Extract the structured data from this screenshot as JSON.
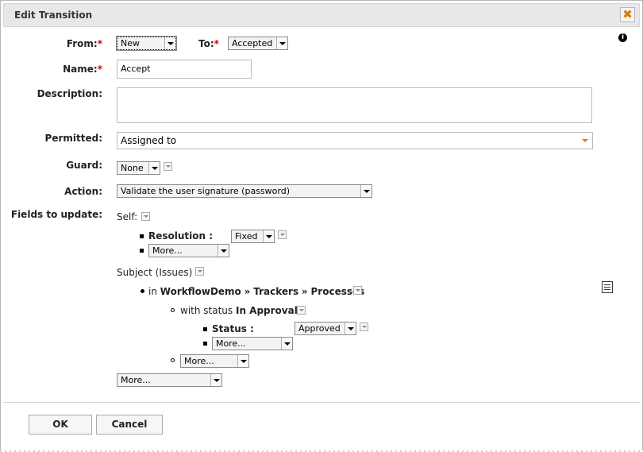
{
  "dialog": {
    "title": "Edit Transition",
    "close_label": "✖"
  },
  "form": {
    "from_label": "From:",
    "from_value": "New",
    "to_label": "To:",
    "to_value": "Accepted",
    "name_label": "Name:",
    "name_value": "Accept",
    "description_label": "Description:",
    "description_value": "",
    "permitted_label": "Permitted:",
    "permitted_value": "Assigned to",
    "guard_label": "Guard:",
    "guard_value": "None",
    "action_label": "Action:",
    "action_value": "Validate the user signature (password)",
    "fields_label": "Fields to update:",
    "required_mark": "*"
  },
  "fields": {
    "self_label": "Self:",
    "resolution_label": "Resolution :",
    "resolution_value": "Fixed",
    "self_more": "More...",
    "subject_label": "Subject (Issues)",
    "path_prefix": "in",
    "path_1": "WorkflowDemo",
    "path_sep": "»",
    "path_2": "Trackers",
    "path_3": "Processes",
    "status_prefix": "with status",
    "status_name": "In Approval",
    "status_colon": ":",
    "status_label": "Status :",
    "status_value": "Approved",
    "status_more": "More...",
    "path_more": "More...",
    "bottom_more": "More..."
  },
  "buttons": {
    "ok": "OK",
    "cancel": "Cancel"
  },
  "icons": {
    "info": "info-icon",
    "doc": "document-icon",
    "close": "close-icon"
  },
  "colors": {
    "required": "#cc0000",
    "close": "#e07b00",
    "permitted_arrow": "#e07b00"
  }
}
